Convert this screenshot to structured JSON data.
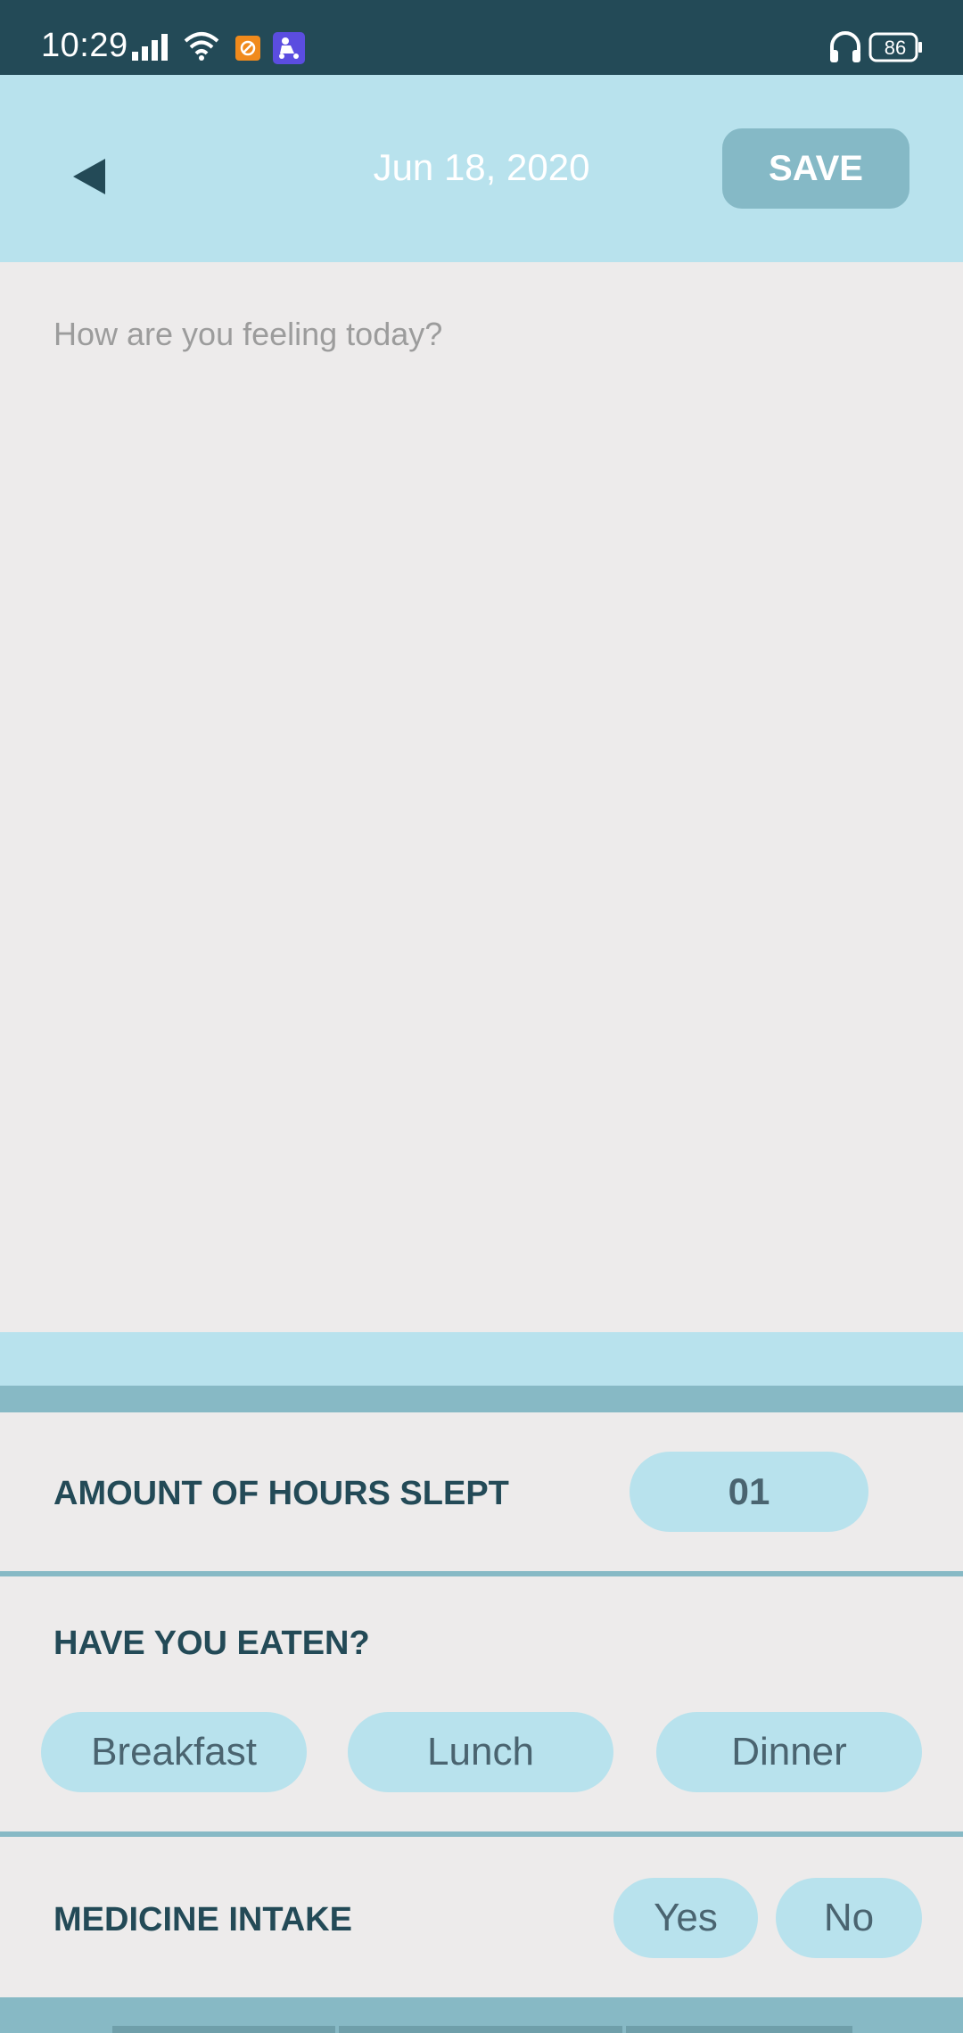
{
  "status_bar": {
    "time": "10:29",
    "battery": "86",
    "icons": [
      "signal-icon",
      "wifi-icon",
      "app-notification-icon",
      "joyride-app-icon",
      "headphones-icon",
      "battery-icon"
    ]
  },
  "header": {
    "back_icon": "back-arrow-icon",
    "date": "Jun 18, 2020",
    "save_label": "SAVE"
  },
  "journal": {
    "placeholder": "How are you feeling today?",
    "value": ""
  },
  "sleep": {
    "label": "AMOUNT OF HOURS SLEPT",
    "value": "01"
  },
  "meals": {
    "label": "HAVE YOU EATEN?",
    "options": [
      "Breakfast",
      "Lunch",
      "Dinner"
    ]
  },
  "medicine": {
    "label": "MEDICINE INTAKE",
    "options": [
      "Yes",
      "No"
    ]
  },
  "colors": {
    "status_bar": "#234a57",
    "header": "#b8e2ed",
    "accent": "#87b9c5",
    "background": "#edebeb",
    "label_text": "#234a57"
  }
}
